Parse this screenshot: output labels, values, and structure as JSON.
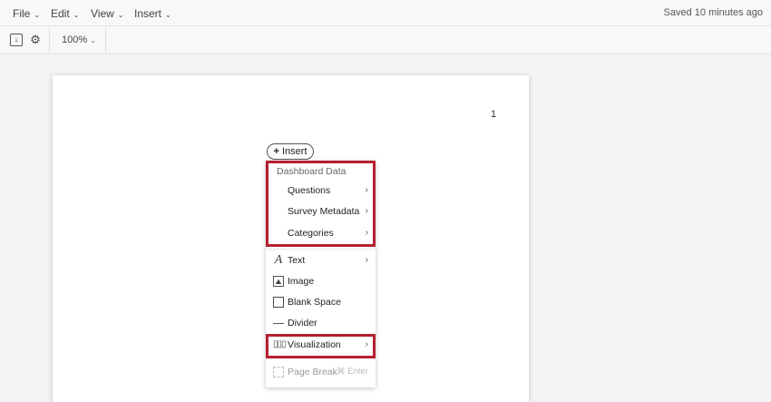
{
  "menubar": {
    "items": [
      "File",
      "Edit",
      "View",
      "Insert"
    ],
    "saved": "Saved 10 minutes ago"
  },
  "toolbar": {
    "zoom": "100%"
  },
  "page": {
    "number": "1",
    "insert_label": "Insert"
  },
  "menu": {
    "section_header": "Dashboard Data",
    "data_items": [
      "Questions",
      "Survey Metadata",
      "Categories"
    ],
    "items": [
      {
        "label": "Text",
        "icon": "text-icon",
        "submenu": true
      },
      {
        "label": "Image",
        "icon": "image-icon",
        "submenu": false
      },
      {
        "label": "Blank Space",
        "icon": "blank-space-icon",
        "submenu": false
      },
      {
        "label": "Divider",
        "icon": "divider-icon",
        "submenu": false
      },
      {
        "label": "Visualization",
        "icon": "bar-chart-icon",
        "submenu": true
      }
    ],
    "page_break": {
      "label": "Page Break",
      "shortcut": "⌘ Enter"
    }
  },
  "colors": {
    "highlight": "#b4202f"
  }
}
